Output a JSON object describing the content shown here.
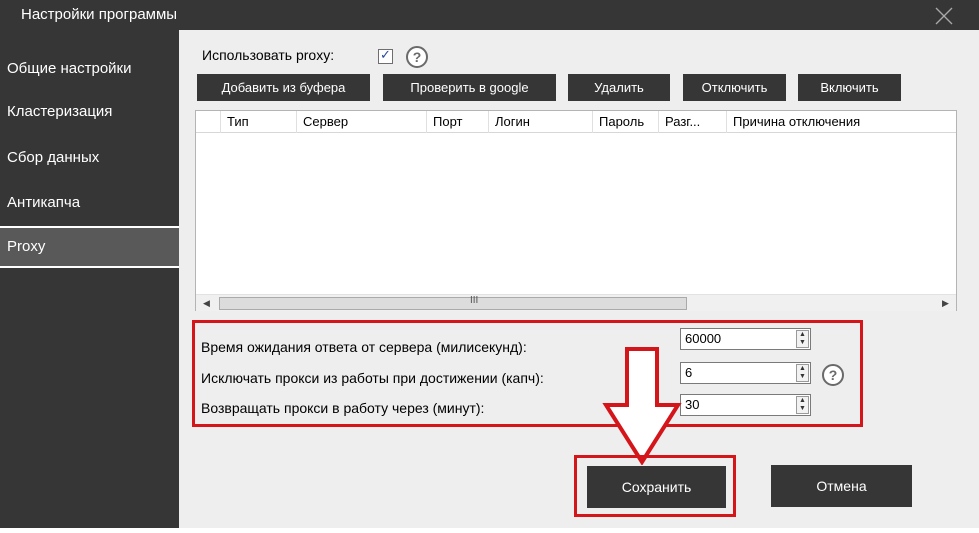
{
  "window": {
    "title": "Настройки программы"
  },
  "sidebar": {
    "items": [
      {
        "label": "Общие настройки",
        "active": false
      },
      {
        "label": "Кластеризация",
        "active": false
      },
      {
        "label": "Сбор данных",
        "active": false
      },
      {
        "label": "Антикапча",
        "active": false
      },
      {
        "label": "Proxy",
        "active": true
      }
    ]
  },
  "proxy": {
    "use_label": "Использовать proxy:",
    "use_checked": true,
    "help_symbol": "?"
  },
  "toolbar": {
    "add_from_clipboard": "Добавить из буфера",
    "check_google": "Проверить в google",
    "delete": "Удалить",
    "disable": "Отключить",
    "enable": "Включить"
  },
  "table": {
    "columns": [
      "Тип",
      "Сервер",
      "Порт",
      "Логин",
      "Пароль",
      "Разг...",
      "Причина отключения"
    ],
    "rows": [],
    "scroll_grip": "III"
  },
  "settings": {
    "timeout_label": "Время ожидания ответа от сервера (милисекунд):",
    "timeout_value": "60000",
    "exclude_label": "Исключать прокси из работы при достижении (капч):",
    "exclude_value": "6",
    "return_label": "Возвращать прокси в работу через (минут):",
    "return_value": "30"
  },
  "footer": {
    "save": "Сохранить",
    "cancel": "Отмена"
  },
  "colors": {
    "dark": "#363636",
    "active_nav": "#595959",
    "content_bg": "#eeeeee",
    "highlight_red": "#d4151a"
  }
}
